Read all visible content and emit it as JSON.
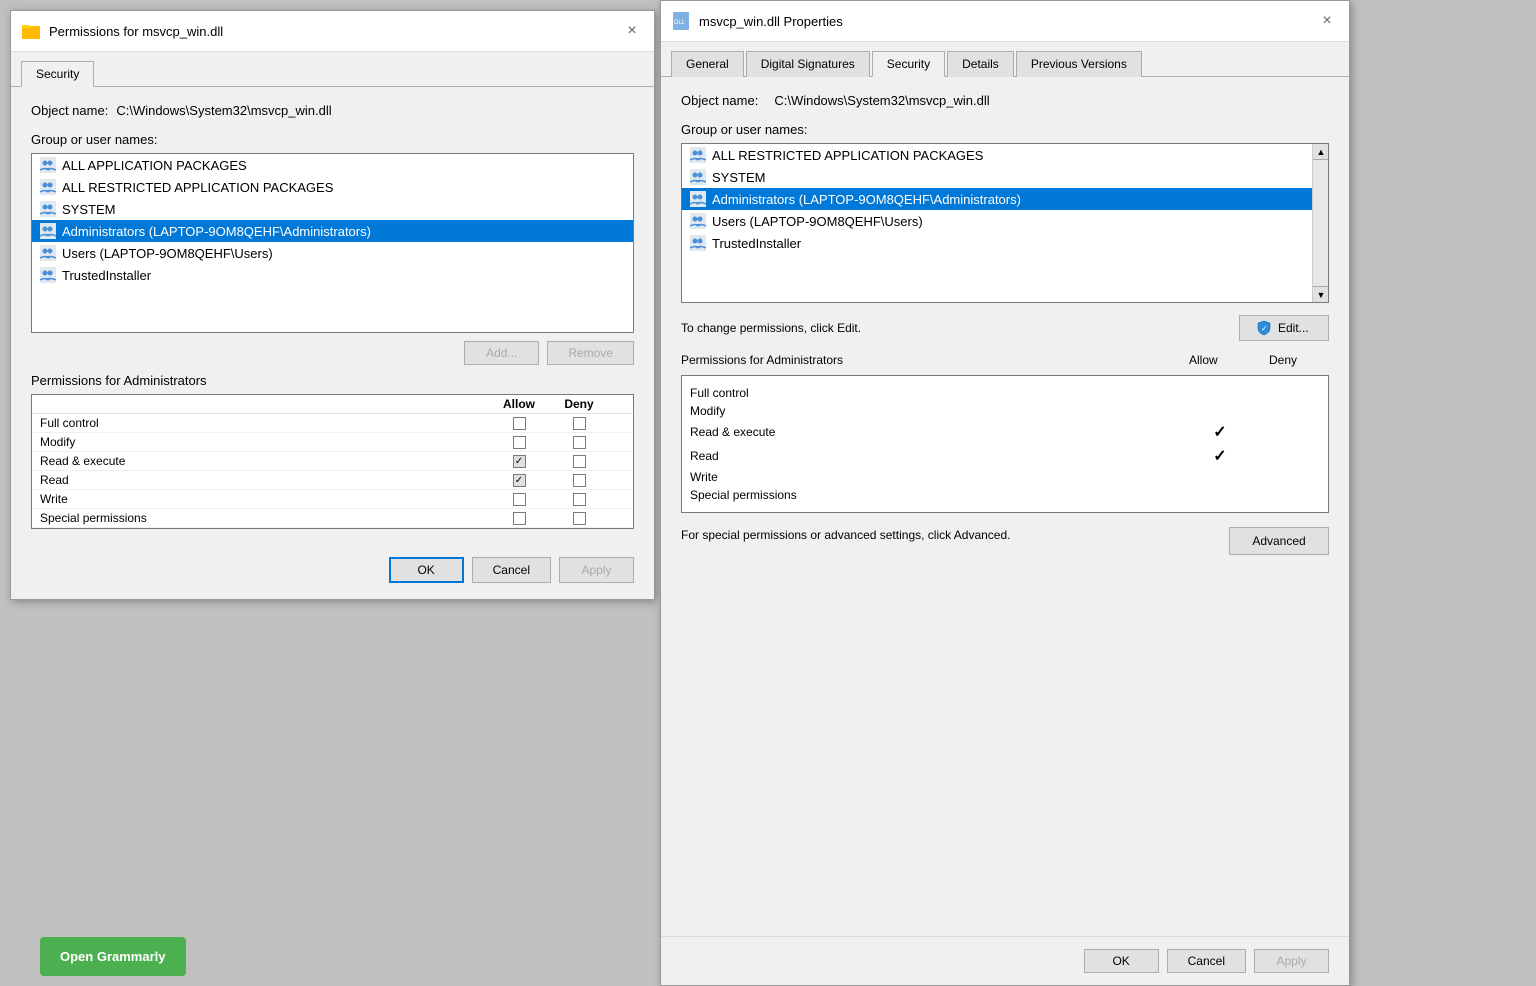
{
  "left_dialog": {
    "title": "Permissions for msvcp_win.dll",
    "close_label": "×",
    "tab_security": "Security",
    "object_name_label": "Object name:",
    "object_name_value": "C:\\Windows\\System32\\msvcp_win.dll",
    "group_users_label": "Group or user names:",
    "users": [
      {
        "name": "ALL APPLICATION PACKAGES",
        "selected": false
      },
      {
        "name": "ALL RESTRICTED APPLICATION PACKAGES",
        "selected": false
      },
      {
        "name": "SYSTEM",
        "selected": false
      },
      {
        "name": "Administrators (LAPTOP-9OM8QEHF\\Administrators)",
        "selected": true
      },
      {
        "name": "Users (LAPTOP-9OM8QEHF\\Users)",
        "selected": false
      },
      {
        "name": "TrustedInstaller",
        "selected": false
      }
    ],
    "add_label": "Add...",
    "remove_label": "Remove",
    "permissions_for_label": "Permissions for Administrators",
    "allow_label": "Allow",
    "deny_label": "Deny",
    "permissions": [
      {
        "name": "Full control",
        "allow": false,
        "deny": false,
        "allow_gray": false
      },
      {
        "name": "Modify",
        "allow": false,
        "deny": false,
        "allow_gray": false
      },
      {
        "name": "Read & execute",
        "allow": true,
        "deny": false,
        "allow_gray": true
      },
      {
        "name": "Read",
        "allow": true,
        "deny": false,
        "allow_gray": true
      },
      {
        "name": "Write",
        "allow": false,
        "deny": false,
        "allow_gray": false
      },
      {
        "name": "Special permissions",
        "allow": false,
        "deny": false,
        "allow_gray": false
      }
    ],
    "ok_label": "OK",
    "cancel_label": "Cancel",
    "apply_label": "Apply"
  },
  "right_dialog": {
    "title": "msvcp_win.dll Properties",
    "close_label": "×",
    "tabs": [
      {
        "label": "General",
        "active": false
      },
      {
        "label": "Digital Signatures",
        "active": false
      },
      {
        "label": "Security",
        "active": true
      },
      {
        "label": "Details",
        "active": false
      },
      {
        "label": "Previous Versions",
        "active": false
      }
    ],
    "object_name_label": "Object name:",
    "object_name_value": "C:\\Windows\\System32\\msvcp_win.dll",
    "group_users_label": "Group or user names:",
    "users": [
      {
        "name": "ALL RESTRICTED APPLICATION PACKAGES",
        "selected": false
      },
      {
        "name": "SYSTEM",
        "selected": false
      },
      {
        "name": "Administrators (LAPTOP-9OM8QEHF\\Administrators)",
        "selected": true
      },
      {
        "name": "Users (LAPTOP-9OM8QEHF\\Users)",
        "selected": false
      },
      {
        "name": "TrustedInstaller",
        "selected": false
      }
    ],
    "change_perms_text": "To change permissions, click Edit.",
    "edit_label": "Edit...",
    "permissions_for_label": "Permissions for Administrators",
    "allow_label": "Allow",
    "deny_label": "Deny",
    "permissions": [
      {
        "name": "Full control",
        "allow": false,
        "deny": false
      },
      {
        "name": "Modify",
        "allow": false,
        "deny": false
      },
      {
        "name": "Read & execute",
        "allow": true,
        "deny": false
      },
      {
        "name": "Read",
        "allow": true,
        "deny": false
      },
      {
        "name": "Write",
        "allow": false,
        "deny": false
      },
      {
        "name": "Special permissions",
        "allow": false,
        "deny": false
      }
    ],
    "advanced_text": "For special permissions or advanced settings, click Advanced.",
    "advanced_label": "Advanced",
    "ok_label": "OK",
    "cancel_label": "Cancel",
    "apply_label": "Apply"
  },
  "grammarly": {
    "label": "Open Grammarly"
  }
}
